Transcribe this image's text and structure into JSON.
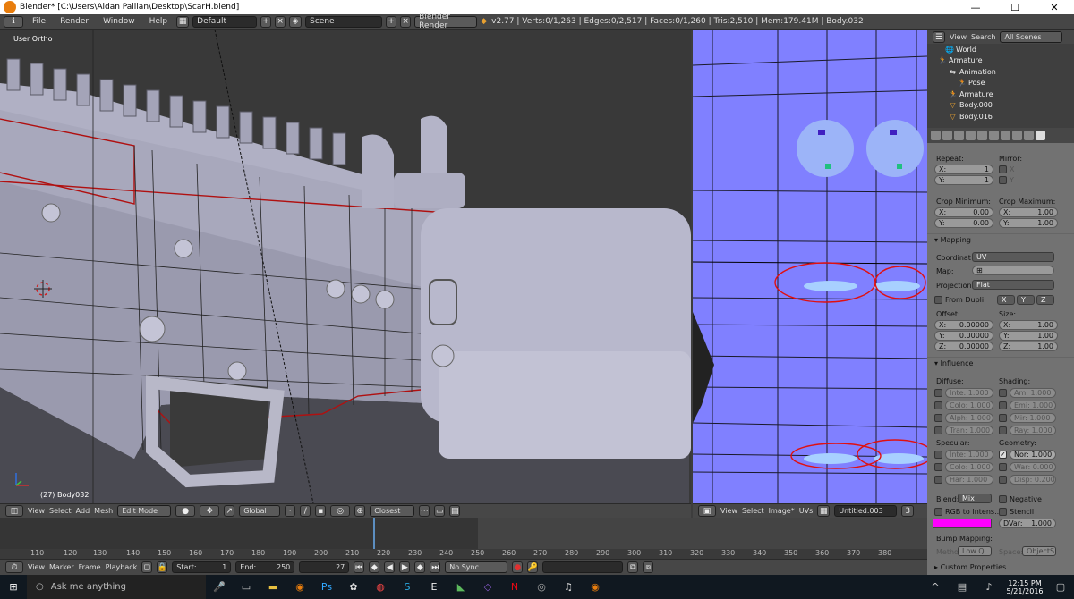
{
  "window": {
    "title": "Blender* [C:\\Users\\Aidan Pallian\\Desktop\\ScarH.blend]",
    "minimize": "—",
    "maximize": "☐",
    "close": "✕"
  },
  "info_bar": {
    "menus": [
      "File",
      "Render",
      "Window",
      "Help"
    ],
    "layout": "Default",
    "scene": "Scene",
    "engine": "Blender Render",
    "stats": "v2.77 | Verts:0/1,263 | Edges:0/2,517 | Faces:0/1,260 | Tris:2,510 | Mem:179.41M | Body.032"
  },
  "viewport": {
    "label": "User Ortho",
    "object_label": "(27) Body032",
    "header": {
      "menus": [
        "View",
        "Select",
        "Add",
        "Mesh"
      ],
      "mode": "Edit Mode",
      "orientation": "Global",
      "snap": "Closest"
    }
  },
  "uv_editor": {
    "header": {
      "menus": [
        "View",
        "Select",
        "Image*",
        "UVs"
      ],
      "image": "Untitled.003",
      "users": "3"
    }
  },
  "timeline": {
    "ruler": [
      "110",
      "120",
      "130",
      "140",
      "150",
      "160",
      "170",
      "180",
      "190",
      "200",
      "210",
      "220",
      "230",
      "240",
      "250",
      "260",
      "270",
      "280",
      "290",
      "300",
      "310",
      "320",
      "330",
      "340",
      "350",
      "360",
      "370",
      "380"
    ],
    "menus": [
      "View",
      "Marker",
      "Frame",
      "Playback"
    ],
    "start": "Start:",
    "start_val": "1",
    "end": "End:",
    "end_val": "250",
    "current": "27",
    "sync": "No Sync"
  },
  "outliner": {
    "menus": [
      "View",
      "Search"
    ],
    "filter": "All Scenes",
    "items": [
      {
        "label": "World",
        "icon": "🌐",
        "indent": 2
      },
      {
        "label": "Armature",
        "icon": "🏃",
        "indent": 1
      },
      {
        "label": "Animation",
        "icon": "⇋",
        "indent": 2
      },
      {
        "label": "Pose",
        "icon": "🏃",
        "indent": 3
      },
      {
        "label": "Armature",
        "icon": "🏃",
        "indent": 2
      },
      {
        "label": "Body.000",
        "icon": "▽",
        "indent": 2
      },
      {
        "label": "Body.016",
        "icon": "▽",
        "indent": 2
      }
    ]
  },
  "properties": {
    "repeat": "Repeat:",
    "mirror": "Mirror:",
    "repeat_x": "X:",
    "repeat_x_val": "1",
    "repeat_y": "Y:",
    "repeat_y_val": "1",
    "mirror_x": "X",
    "mirror_y": "Y",
    "crop_min": "Crop Minimum:",
    "crop_max": "Crop Maximum:",
    "cmin_x": "X:",
    "cmin_x_val": "0.00",
    "cmin_y": "Y:",
    "cmin_y_val": "0.00",
    "cmax_x": "X:",
    "cmax_x_val": "1.00",
    "cmax_y": "Y:",
    "cmax_y_val": "1.00",
    "mapping": "Mapping",
    "coordinate": "Coordinat",
    "coordinate_val": "UV",
    "map": "Map:",
    "projection": "Projection:",
    "projection_val": "Flat",
    "from_dupli": "From Dupli",
    "offset": "Offset:",
    "size": "Size:",
    "off_x": "X:",
    "off_x_val": "0.00000",
    "off_y": "Y:",
    "off_y_val": "0.00000",
    "off_z": "Z:",
    "off_z_val": "0.00000",
    "size_x": "X:",
    "size_x_val": "1.00",
    "size_y": "Y:",
    "size_y_val": "1.00",
    "size_z": "Z:",
    "size_z_val": "1.00",
    "influence": "Influence",
    "diffuse": "Diffuse:",
    "shading": "Shading:",
    "inte": "Inte: 1.000",
    "colo": "Colo: 1.000",
    "alph": "Alph: 1.000",
    "tran": "Tran: 1.000",
    "am": "Am: 1.000",
    "emi": "Emi: 1.000",
    "mir": "Mir: 1.000",
    "ray": "Ray: 1.000",
    "specular": "Specular:",
    "geometry": "Geometry:",
    "sinte": "Inte: 1.000",
    "scolo": "Colo: 1.000",
    "shar": "Har: 1.000",
    "nor": "Nor: 1.000",
    "war": "War: 0.000",
    "disp": "Disp: 0.200",
    "blend": "Blend:",
    "blend_val": "Mix",
    "negative": "Negative",
    "rgb_to": "RGB to Intens...",
    "stencil": "Stencil",
    "dvar": "DVar:",
    "dvar_val": "1.000",
    "bump": "Bump Mapping:",
    "method": "Metho",
    "method_val": "Low Q",
    "space": "Space:",
    "space_val": "ObjectS",
    "custom": "Custom Properties",
    "color_swatch": "#ff00ff"
  },
  "taskbar": {
    "search": "Ask me anything",
    "time": "12:15 PM",
    "date": "5/21/2016"
  }
}
